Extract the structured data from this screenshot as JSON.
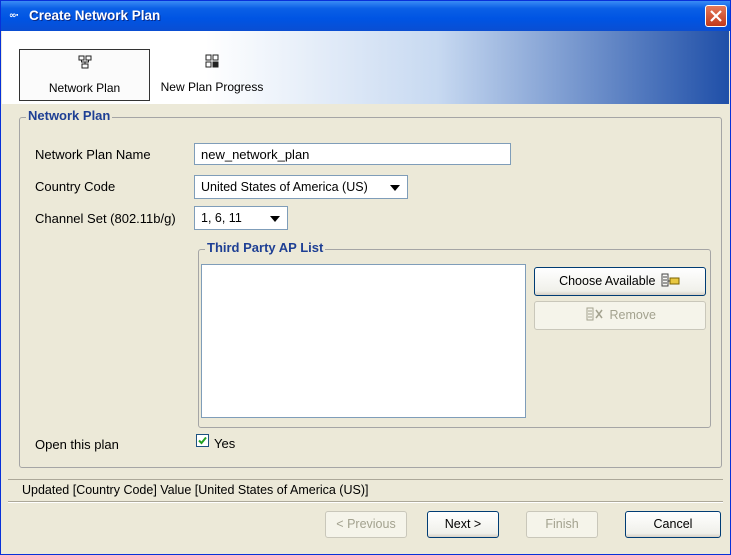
{
  "window": {
    "title": "Create Network Plan",
    "app_icon_text": "∞∙"
  },
  "toolbar": {
    "tabs": [
      {
        "label": "Network Plan",
        "active": true,
        "icon": "network-tree-icon"
      },
      {
        "label": "New Plan Progress",
        "active": false,
        "icon": "progress-grid-icon"
      }
    ]
  },
  "form": {
    "group_title": "Network Plan",
    "network_plan_name": {
      "label": "Network Plan Name",
      "value": "new_network_plan"
    },
    "country_code": {
      "label": "Country Code",
      "value": "United States of America (US)"
    },
    "channel_set": {
      "label": "Channel Set (802.11b/g)",
      "value": "1, 6, 11"
    },
    "ap_list": {
      "group_title": "Third Party AP List",
      "items": [],
      "choose_button": "Choose Available",
      "remove_button": "Remove"
    },
    "open_plan": {
      "label": "Open this plan",
      "checkbox_label": "Yes",
      "checked": true
    }
  },
  "status_text": "Updated [Country Code] Value [United States of America (US)]",
  "footer": {
    "previous": "< Previous",
    "next": "Next >",
    "finish": "Finish",
    "cancel": "Cancel"
  },
  "colors": {
    "titlebar": "#0054e3",
    "group_title": "#1e3f94",
    "window_bg": "#ece9d8"
  }
}
